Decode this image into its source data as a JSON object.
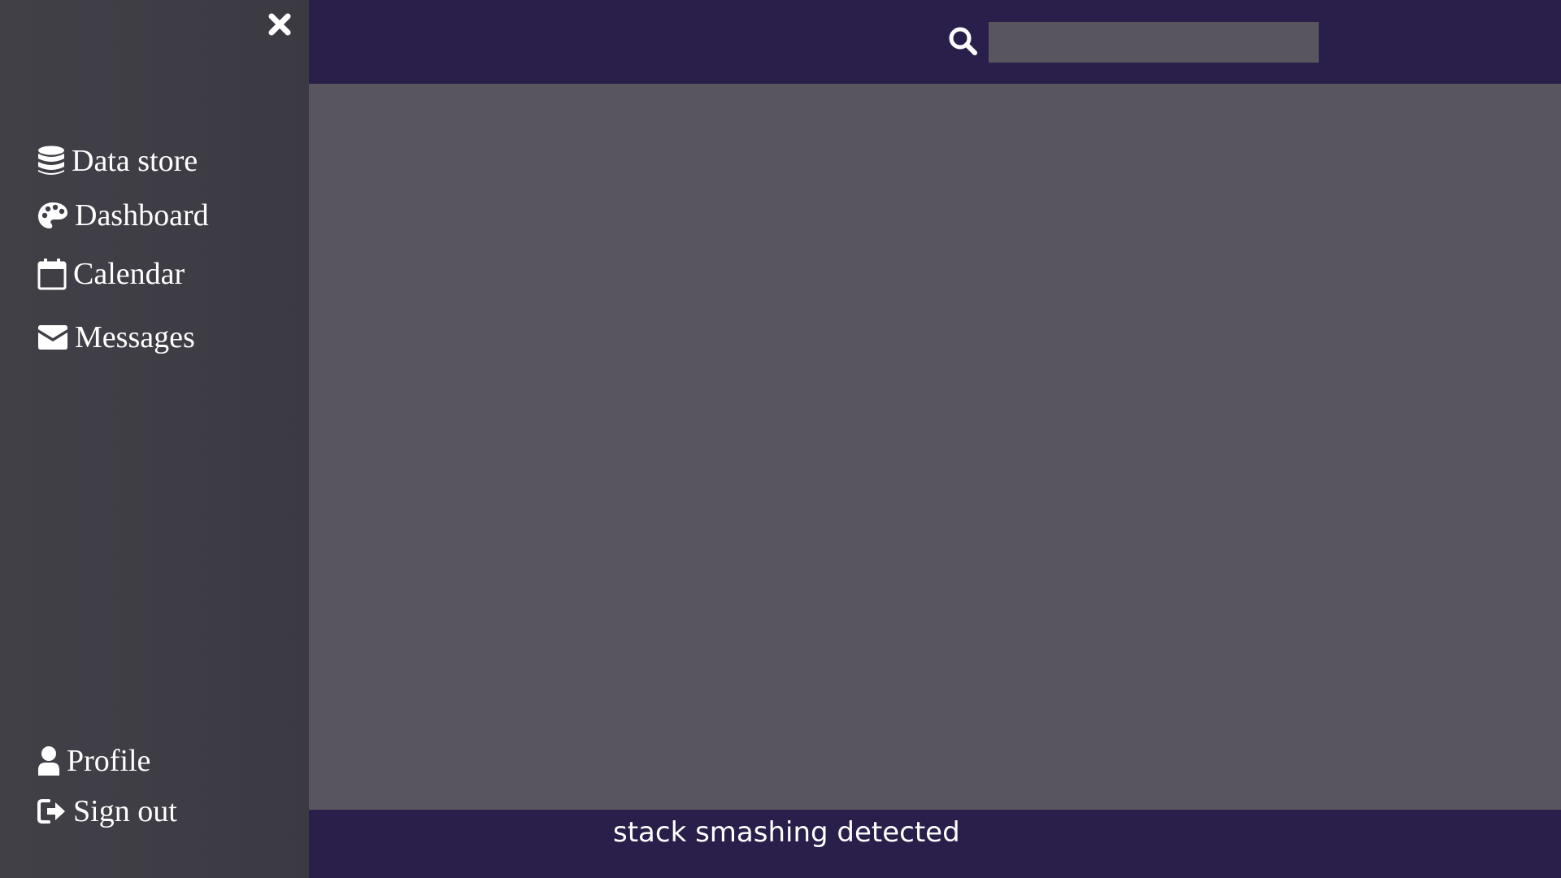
{
  "sidebar": {
    "close_icon": "close-icon",
    "items": [
      {
        "label": "Data store",
        "icon": "database-icon"
      },
      {
        "label": "Dashboard",
        "icon": "palette-icon"
      },
      {
        "label": "Calendar",
        "icon": "calendar-icon"
      },
      {
        "label": "Messages",
        "icon": "envelope-icon"
      }
    ],
    "footer_items": [
      {
        "label": "Profile",
        "icon": "user-icon"
      },
      {
        "label": "Sign out",
        "icon": "sign-out-icon"
      }
    ]
  },
  "header": {
    "search": {
      "icon": "search-icon",
      "value": "",
      "placeholder": ""
    }
  },
  "status": {
    "message": "stack smashing detected"
  },
  "colors": {
    "sidebar_bg": "#3f3d45",
    "topbar_bg": "#2a1f4a",
    "content_bg": "#58555f",
    "text": "#ffffff"
  }
}
